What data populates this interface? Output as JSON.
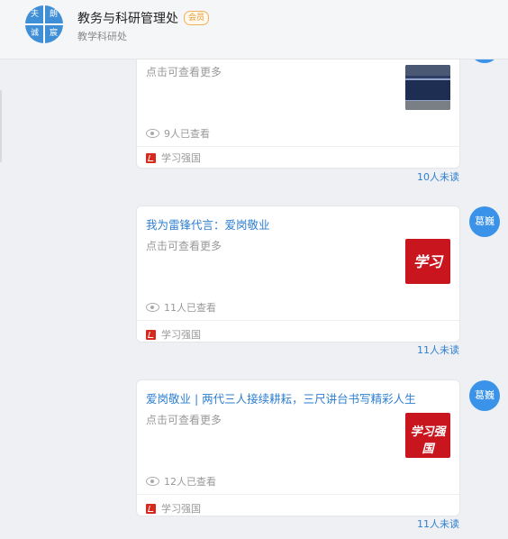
{
  "header": {
    "logo_chars": [
      "夫",
      "朗",
      "诚",
      "宸"
    ],
    "org_name": "教务与科研管理处",
    "badge": "会员",
    "subtitle": "教学科研处"
  },
  "messages": [
    {
      "title": "",
      "desc": "点击可查看更多",
      "thumb": "blue-sign-image",
      "views": "9人已查看",
      "source": "学习强国",
      "unread": "10人未读",
      "avatar": ""
    },
    {
      "title": "我为雷锋代言：爱岗敬业",
      "desc": "点击可查看更多",
      "thumb": "xuexi-red-image",
      "views": "11人已查看",
      "source": "学习强国",
      "unread": "11人未读",
      "avatar": "葛巍"
    },
    {
      "title": "爱岗敬业 | 两代三人接续耕耘，三尺讲台书写精彩人生",
      "desc": "点击可查看更多",
      "thumb": "xuexi-qiangguo-red-image",
      "views": "12人已查看",
      "source": "学习强国",
      "unread": "11人未读",
      "avatar": "葛巍"
    }
  ],
  "colors": {
    "accent": "#2e7fd1",
    "avatar_bg": "#3a93e8",
    "badge": "#e89a2a"
  }
}
